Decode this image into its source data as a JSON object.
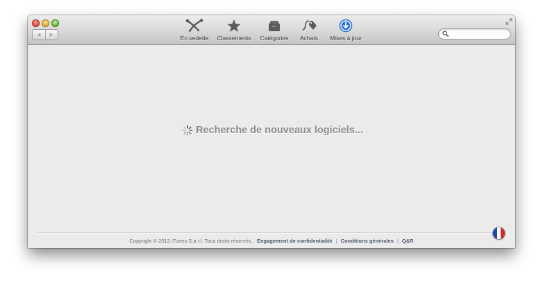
{
  "toolbar": {
    "items": [
      {
        "label": "En vedette",
        "icon": "featured-icon",
        "active": false
      },
      {
        "label": "Classements",
        "icon": "star-icon",
        "active": false
      },
      {
        "label": "Catégories",
        "icon": "categories-icon",
        "active": false
      },
      {
        "label": "Achats",
        "icon": "purchases-icon",
        "active": false
      },
      {
        "label": "Mises à jour",
        "icon": "updates-icon",
        "active": true
      }
    ]
  },
  "search": {
    "value": "",
    "placeholder": ""
  },
  "main": {
    "loading_text": "Recherche de nouveaux logiciels..."
  },
  "footer": {
    "copyright": "Copyright © 2012 iTunes S.à r.l. Tous droits réservés.",
    "links": [
      "Engagement de confidentialité",
      "Conditions générales",
      "Q&R"
    ],
    "separator": "|"
  },
  "country": {
    "name": "France",
    "colors": [
      "#1f45a8",
      "#ffffff",
      "#d7262d"
    ]
  },
  "colors": {
    "accent": "#2a74d8"
  }
}
